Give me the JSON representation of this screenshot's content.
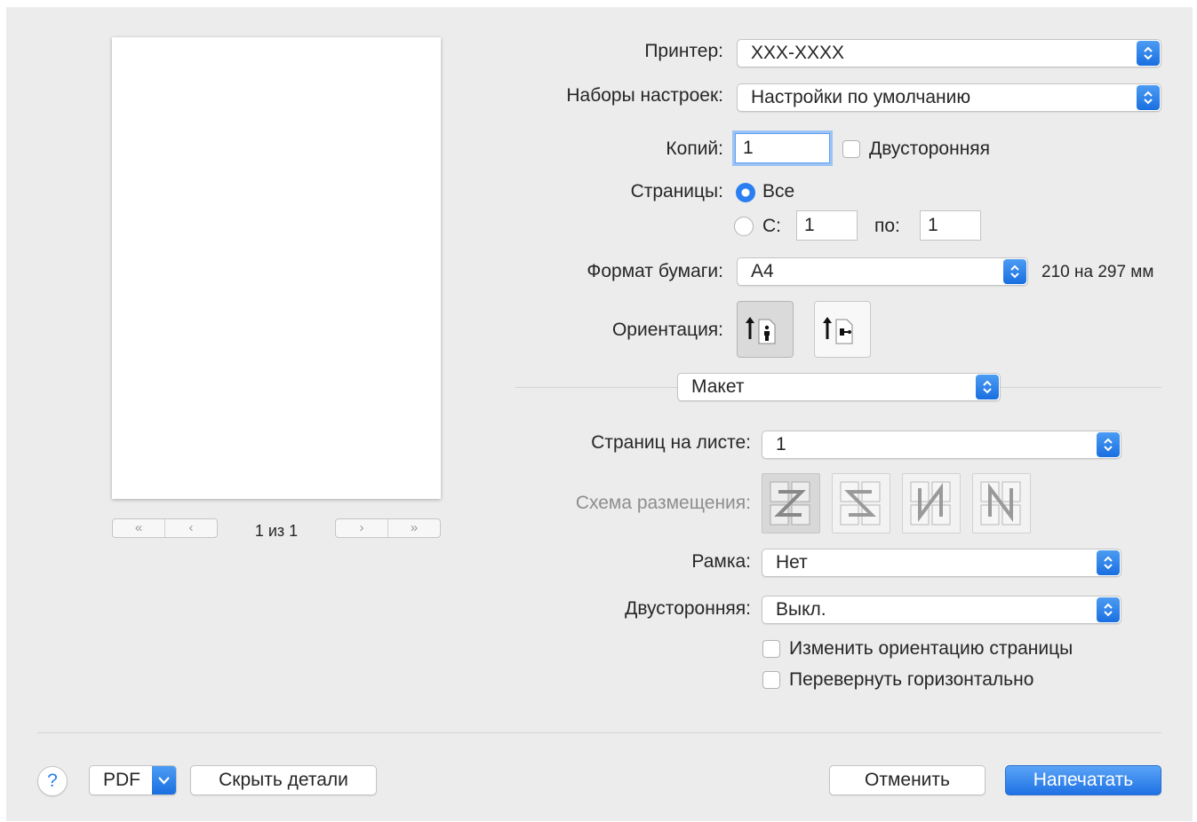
{
  "printer": {
    "label": "Принтер:",
    "value": "XXX-XXXX"
  },
  "presets": {
    "label": "Наборы настроек:",
    "value": "Настройки по умолчанию"
  },
  "copies": {
    "label": "Копий:",
    "value": "1",
    "two_sided_label": "Двусторонняя"
  },
  "pages": {
    "label": "Страницы:",
    "all_label": "Все",
    "from_label": "С:",
    "from_value": "1",
    "to_label": "по:",
    "to_value": "1",
    "selected": "all"
  },
  "paper": {
    "label": "Формат бумаги:",
    "value": "A4",
    "size_text": "210 на 297 мм"
  },
  "orientation": {
    "label": "Ориентация:",
    "selected": "portrait"
  },
  "section": {
    "value": "Макет"
  },
  "layout": {
    "pages_per_sheet_label": "Страниц на листе:",
    "pages_per_sheet_value": "1",
    "direction_label": "Схема размещения:",
    "direction_icons": [
      "layout-z-icon",
      "layout-s-reverse-icon",
      "layout-n-reverse-icon",
      "layout-n-icon"
    ],
    "border_label": "Рамка:",
    "border_value": "Нет",
    "two_sided_label": "Двусторонняя:",
    "two_sided_value": "Выкл.",
    "reverse_orientation_label": "Изменить ориентацию страницы",
    "flip_horizontal_label": "Перевернуть горизонтально"
  },
  "preview": {
    "page_count": "1 из 1"
  },
  "buttons": {
    "help": "?",
    "pdf": "PDF",
    "hide_details": "Скрыть детали",
    "cancel": "Отменить",
    "print": "Напечатать"
  },
  "colors": {
    "accent": "#2b7ef1",
    "background": "#ececec"
  }
}
